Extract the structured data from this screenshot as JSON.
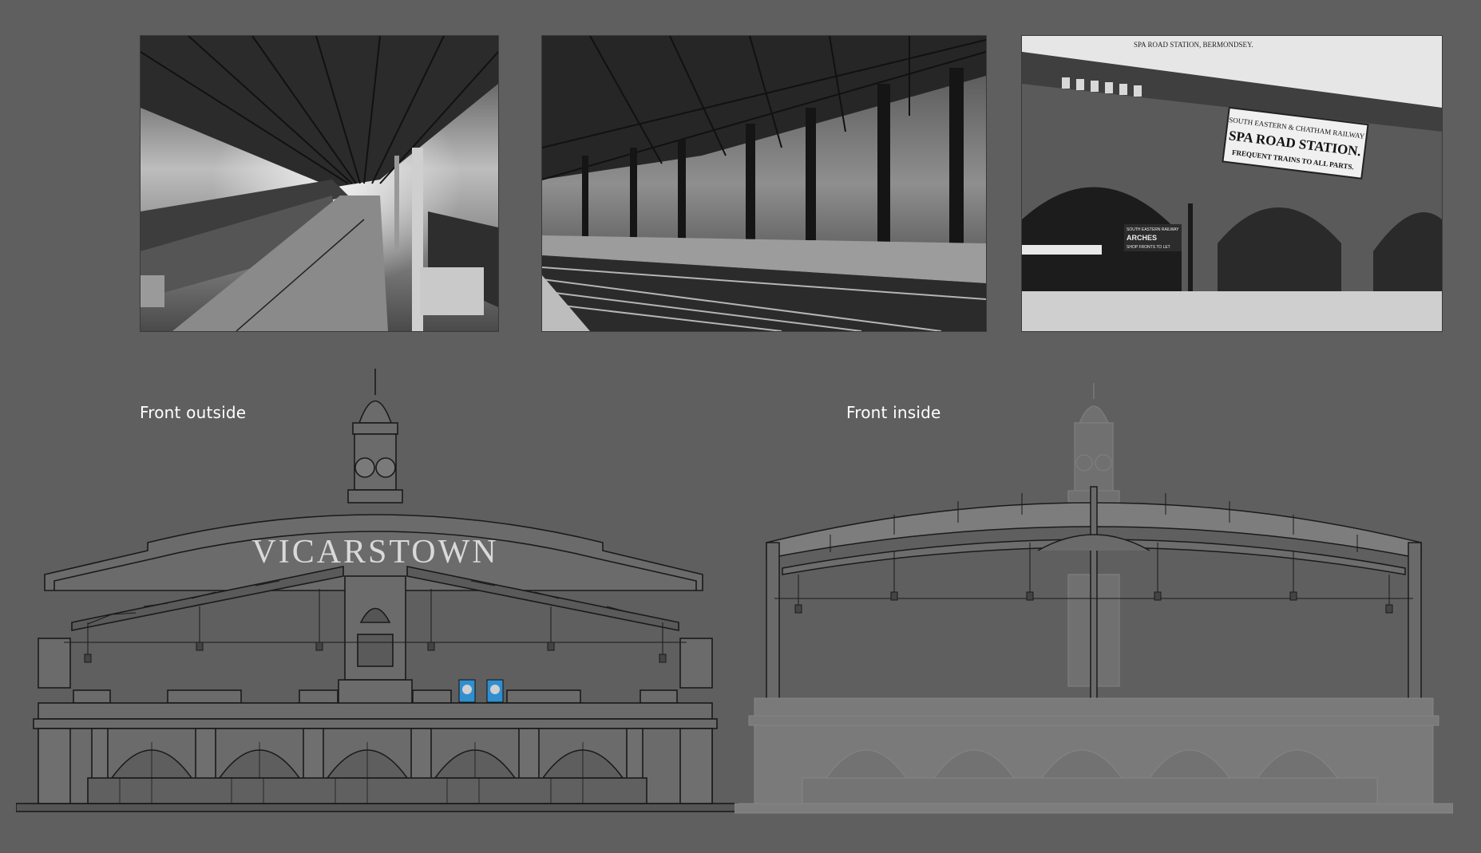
{
  "reference_photos": [
    {
      "name": "platform-interior-photo-1"
    },
    {
      "name": "platform-interior-photo-2"
    },
    {
      "name": "spa-road-station-photo",
      "header_text": "SPA ROAD STATION, BERMONDSEY.",
      "sign_line1": "SOUTH EASTERN & CHATHAM RAILWAY",
      "sign_line2": "SPA ROAD STATION.",
      "sign_line3": "FREQUENT TRAINS TO ALL PARTS.",
      "arch_sign_line1": "SOUTH EASTERN RAILWAY",
      "arch_sign_line2": "ARCHES",
      "arch_sign_line3": "SHOP FRONTS TO LET"
    }
  ],
  "captions": {
    "outside": "Front outside",
    "inside": "Front inside"
  },
  "station": {
    "name": "VICARSTOWN"
  },
  "colors": {
    "background": "#5f5f5f",
    "facade_line": "#1a1a1a",
    "facade_fill": "#6b6b6b",
    "ghost_fill": "#777777",
    "engine_blue": "#2f8fd0"
  }
}
